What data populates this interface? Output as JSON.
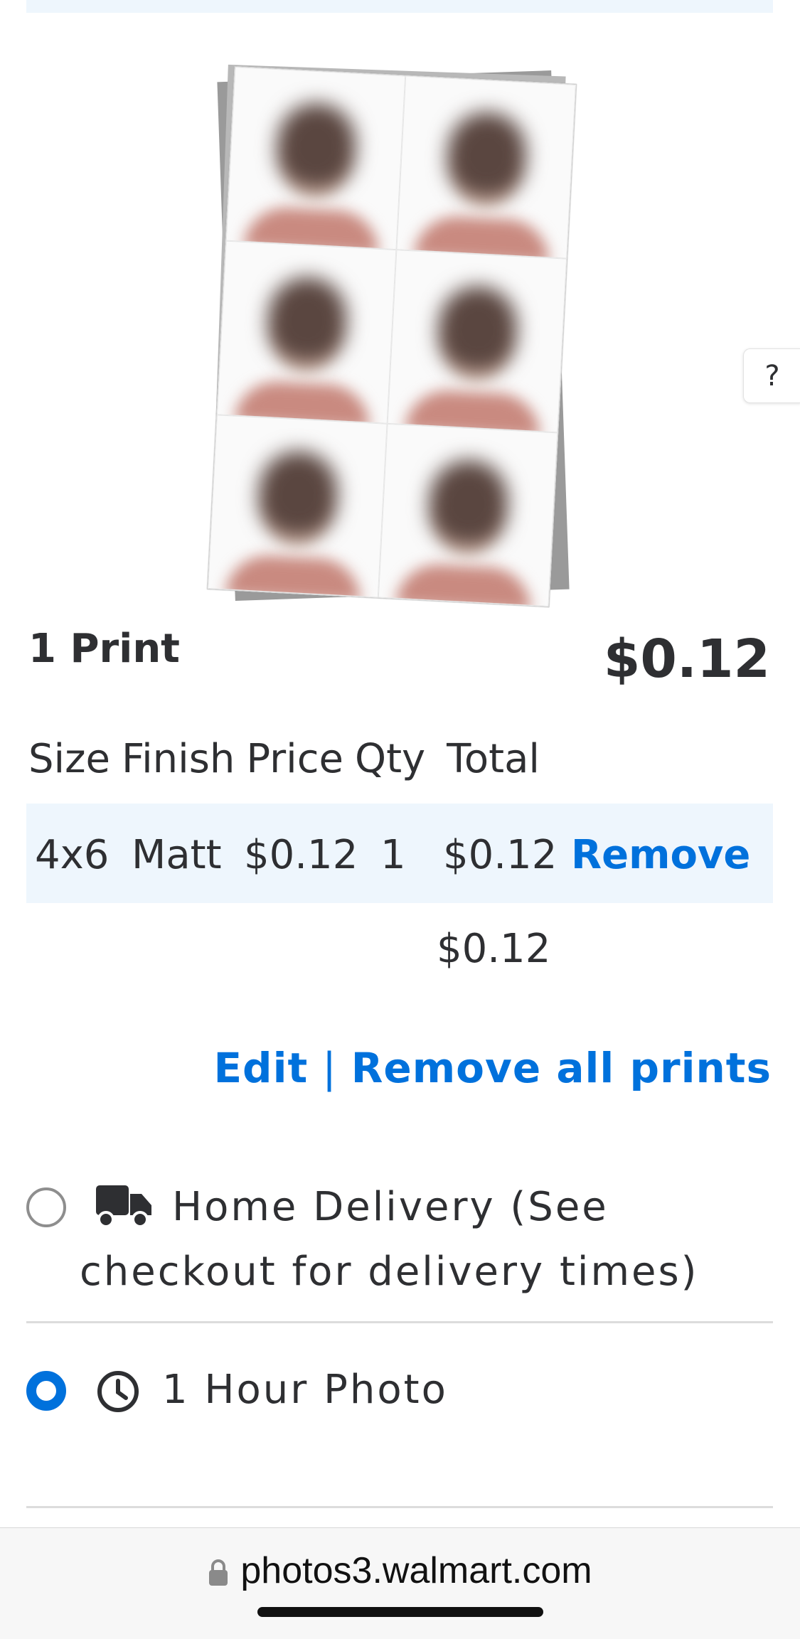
{
  "preview": {
    "alt": "passport photo sheet preview"
  },
  "help": {
    "label": "?"
  },
  "summary": {
    "print_count": "1 Print",
    "price": "$0.12"
  },
  "table": {
    "headers": [
      "Size",
      "Finish",
      "Price",
      "Qty",
      "Total"
    ],
    "row": {
      "size": "4x6",
      "finish": "Matt",
      "price": "$0.12",
      "qty": "1",
      "total": "$0.12",
      "remove": "Remove"
    },
    "subtotal": "$0.12"
  },
  "actions": {
    "edit": "Edit",
    "separator": "|",
    "remove_all": "Remove all prints"
  },
  "options": {
    "home_delivery": {
      "line1": "Home Delivery (See",
      "line2": "checkout for delivery times)",
      "selected": false
    },
    "one_hour": {
      "label": "1 Hour Photo",
      "selected": true
    }
  },
  "browser": {
    "url": "photos3.walmart.com"
  },
  "colors": {
    "accent": "#0071dc",
    "row_bg": "#eef6fd"
  }
}
